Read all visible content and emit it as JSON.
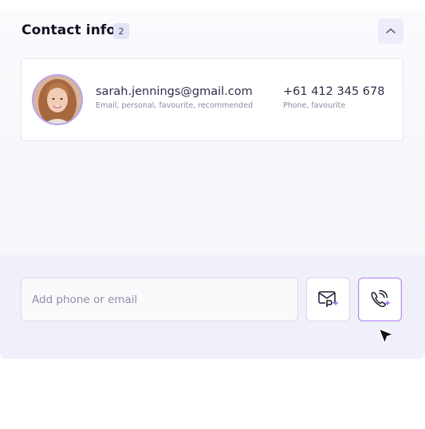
{
  "header": {
    "title": "Contact info",
    "count": "2"
  },
  "contact": {
    "email": "sarah.jennings@gmail.com",
    "email_tags": "Email, personal, favourite, recommended",
    "phone": "+61 412 345 678",
    "phone_tags": "Phone, favourite"
  },
  "input": {
    "placeholder": "Add phone or email"
  },
  "icons": {
    "collapse": "chevron-up-icon",
    "email_action": "mail-sparkle-icon",
    "phone_action": "phone-sparkle-icon",
    "cursor": "mouse-pointer-icon"
  },
  "colors": {
    "accent": "#b58cf0",
    "badge_bg": "#e4e4f7",
    "avatar_ring": "#b7a4f0"
  }
}
